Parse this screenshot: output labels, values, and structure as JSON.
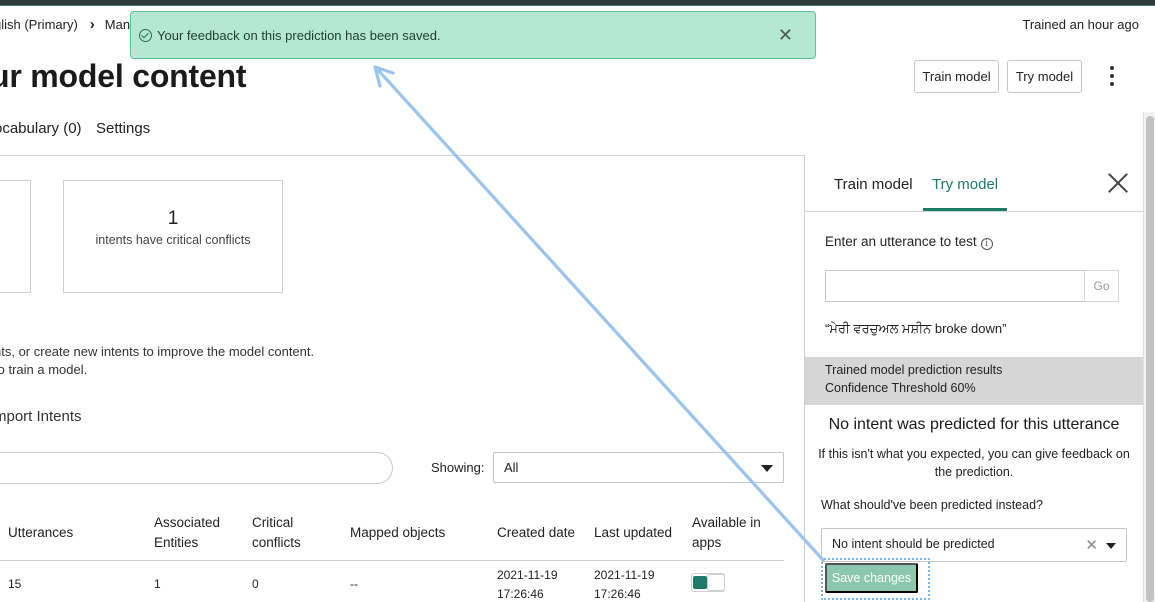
{
  "breadcrumb": {
    "item1": "glish (Primary)",
    "item2": "Man"
  },
  "trained_status": "Trained  an hour ago",
  "toast": {
    "message": "Your feedback on this prediction has been saved."
  },
  "page_title": "ur model content",
  "header_buttons": {
    "train": "Train model",
    "try": "Try model"
  },
  "tabs": {
    "vocabulary": "ocabulary (0)",
    "settings": "Settings"
  },
  "summary_cards": {
    "conflicts_count": "1",
    "conflicts_label": "intents have critical conflicts"
  },
  "description": {
    "line1": "nts, or create new intents to improve the model content.",
    "line2": " to train a model."
  },
  "import_link": "mport Intents",
  "filter": {
    "showing_label": "Showing:",
    "showing_value": "All"
  },
  "table": {
    "headers": {
      "utterances": "Utterances",
      "associated_line1": "Associated",
      "associated_line2": "Entities",
      "critical_line1": "Critical",
      "critical_line2": "conflicts",
      "mapped": "Mapped objects",
      "created": "Created date",
      "updated": "Last updated",
      "available_line1": "Available in",
      "available_line2": "apps"
    },
    "rows": [
      {
        "utterances": "15",
        "entities": "1",
        "conflicts": "0",
        "mapped": "--",
        "created_date": "2021-11-19",
        "created_time": "17:26:46",
        "updated_date": "2021-11-19",
        "updated_time": "17:26:46",
        "available": true
      }
    ]
  },
  "panel": {
    "tab_train": "Train model",
    "tab_try": "Try model",
    "utterance_label": "Enter an utterance to test",
    "go_button": "Go",
    "tested_utterance": "“ਮੇਰੀ ਵਰਚੁਅਲ ਮਸ਼ੀਨ broke down”",
    "results_line1": "Trained model prediction results",
    "results_line2": "Confidence Threshold 60%",
    "no_intent": "No intent was predicted for this utterance",
    "feedback_text": "If this isn't what you expected, you can give feedback on the prediction.",
    "what_label": "What should've been predicted instead?",
    "selected_option": "No intent should be predicted",
    "save_button": "Save changes"
  },
  "colors": {
    "accent": "#1f7a68",
    "toast_bg": "#b4e8d2",
    "annotation_arrow": "#9ac4ee"
  }
}
